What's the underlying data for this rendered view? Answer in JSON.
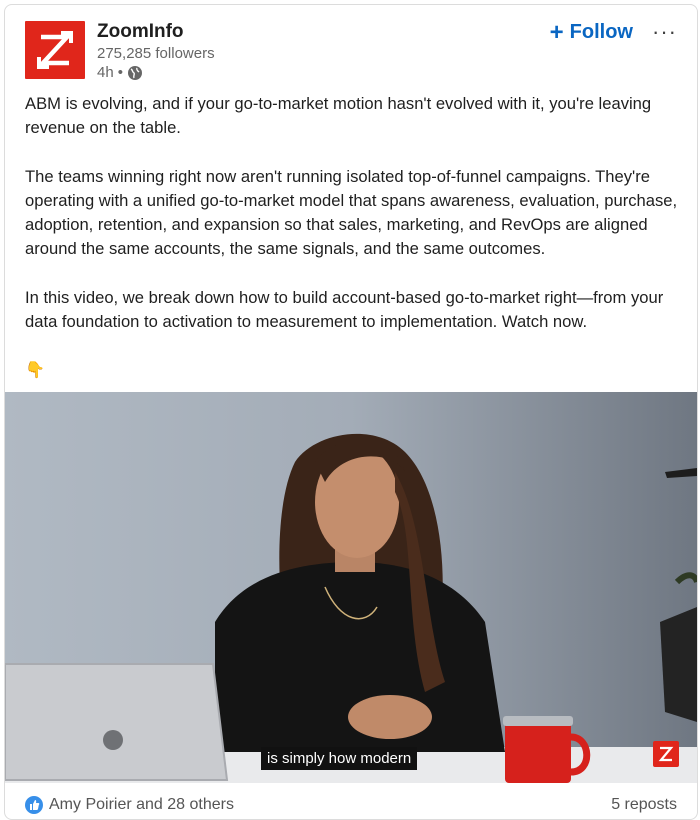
{
  "post": {
    "company": "ZoomInfo",
    "followers": "275,285 followers",
    "time": "4h",
    "separator": "•",
    "follow_label": "Follow",
    "follow_plus": "+",
    "more_label": "···",
    "paragraphs": [
      "ABM is evolving, and if your go-to-market motion hasn't evolved with it, you're leaving revenue on the table.",
      "The teams winning right now aren't running isolated top-of-funnel campaigns. They're operating with a unified go-to-market model that spans awareness, evaluation, purchase, adoption, retention, and expansion so that sales, marketing, and RevOps are aligned around the same accounts, the same signals, and the same outcomes.",
      "In this video, we break down how to build account-based go-to-market right—from your data foundation to activation to measurement to implementation. Watch now."
    ],
    "emoji": "👇"
  },
  "video": {
    "caption": "is simply how modern"
  },
  "footer": {
    "reactions": "Amy Poirier and 28 others",
    "reposts": "5 reposts"
  },
  "colors": {
    "brand": "#e0261b",
    "link": "#0a66c2",
    "like": "#378fe9"
  }
}
